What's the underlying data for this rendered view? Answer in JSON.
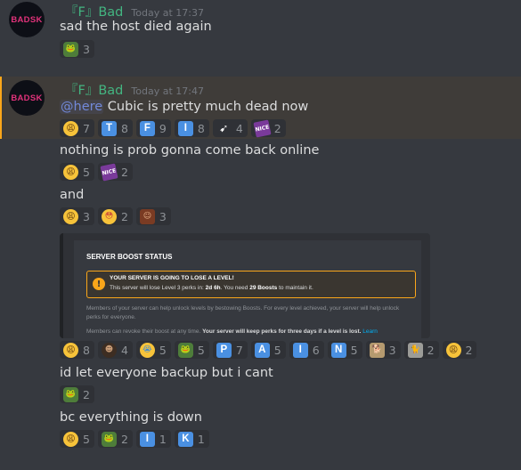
{
  "messages": [
    {
      "username": "『F』Bad",
      "timestamp": "Today at 17:37",
      "avatar_text": "BADSK",
      "lines": [
        {
          "text": "sad the host died again",
          "reactions": [
            {
              "emoji": "frog",
              "count": "3"
            }
          ]
        }
      ]
    },
    {
      "username": "『F』Bad",
      "timestamp": "Today at 17:47",
      "avatar_text": "BADSK",
      "mention": "@here",
      "lines": [
        {
          "text": "Cubic is pretty much dead now",
          "reactions": [
            {
              "emoji": "weary",
              "count": "7"
            },
            {
              "emoji": "T",
              "count": "8"
            },
            {
              "emoji": "F",
              "count": "9"
            },
            {
              "emoji": "I",
              "count": "8"
            },
            {
              "emoji": "cursor",
              "count": "4"
            },
            {
              "emoji": "NICE",
              "count": "2"
            }
          ]
        },
        {
          "text": "nothing is prob gonna come back online",
          "reactions": [
            {
              "emoji": "weary",
              "count": "5"
            },
            {
              "emoji": "NICE",
              "count": "2"
            }
          ]
        },
        {
          "text": "and",
          "reactions": [
            {
              "emoji": "weary",
              "count": "3"
            },
            {
              "emoji": "flushed",
              "count": "2"
            },
            {
              "emoji": "face",
              "count": "3"
            }
          ]
        },
        {
          "embed": {
            "title": "SERVER BOOST STATUS",
            "warn_title": "YOUR SERVER IS GOING TO LOSE A LEVEL!",
            "warn_body_1": "This server will lose Level 3 perks in:",
            "warn_time": "2d 6h",
            "warn_body_2": ". You need",
            "warn_boosts": "29 Boosts",
            "warn_body_3": "to maintain it.",
            "para_1": "Members of your server can help unlock levels by bestowing Boosts. For every level achieved, your server will help unlock perks for everyone.",
            "para_2a": "Members can revoke their boost at any time.",
            "para_2b": "Your server will keep perks for three days if a level is lost.",
            "para_2c": "Learn"
          },
          "reactions": [
            {
              "emoji": "weary",
              "count": "8"
            },
            {
              "emoji": "dark",
              "count": "4"
            },
            {
              "emoji": "cry",
              "count": "5"
            },
            {
              "emoji": "frog",
              "count": "5"
            },
            {
              "emoji": "P",
              "count": "7"
            },
            {
              "emoji": "A",
              "count": "5"
            },
            {
              "emoji": "I",
              "count": "6"
            },
            {
              "emoji": "N",
              "count": "5"
            },
            {
              "emoji": "dog",
              "count": "3"
            },
            {
              "emoji": "cat",
              "count": "2"
            },
            {
              "emoji": "weary",
              "count": "2"
            }
          ]
        },
        {
          "text": "id let everyone backup but i cant",
          "reactions": [
            {
              "emoji": "frog",
              "count": "2"
            }
          ]
        },
        {
          "text": "bc everything is down",
          "reactions": [
            {
              "emoji": "weary",
              "count": "5"
            },
            {
              "emoji": "frog",
              "count": "2"
            },
            {
              "emoji": "I",
              "count": "1"
            },
            {
              "emoji": "K",
              "count": "1"
            }
          ]
        }
      ]
    }
  ]
}
